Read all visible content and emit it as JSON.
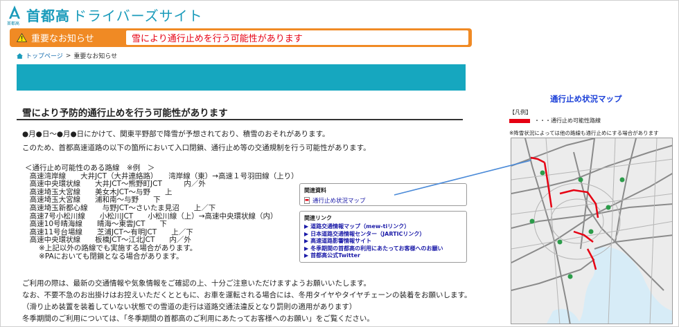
{
  "header": {
    "logo_sub": "首都高",
    "title_kanji": "首都高",
    "title_rest": "ドライバーズサイト"
  },
  "alert": {
    "label": "重要なお知らせ",
    "message": "雪により通行止めを行う可能性があります"
  },
  "breadcrumb": {
    "home": "トップページ",
    "separator": ">",
    "current": "重要なお知らせ"
  },
  "main": {
    "title": "雪により予防的通行止めを行う可能性があります",
    "intro_1": "●月●日～●月●日にかけて、関東平野部で降雪が予想されており、積雪のおそれがあります。",
    "intro_2": "このため、首都高速道路の以下の箇所において入口閉鎖、通行止め等の交通規制を行う可能性があります。",
    "routes_header": "＜通行止め可能性のある路線　※例　＞",
    "routes": [
      "  高速湾岸線　　大井JCT（大井連絡路）　　湾岸線（東）→高速１号羽田線（上り）",
      "  高速中央環状線　　大井JCT～熊野町JCT　　　内／外",
      "  高速埼玉大宮線　　美女木JCT～与野　　上",
      "  高速埼玉大宮線　　浦和南～与野　　下",
      "  高速埼玉新都心線　　与野JCT～さいたま見沼　　上／下",
      "  高速7号小松川線　　小松川JCT　　小松川線（上）→高速中央環状線（内）",
      "  高速10号晴海線　　晴海～東雲JCT　　下",
      "  高速11号台場線　　芝浦JCT～有明JCT　　上／下",
      "  高速中央環状線　　板橋JCT～江北JCT　　内／外"
    ],
    "routes_note_1": "      ※上記以外の路線でも実施する場合があります。",
    "routes_note_2": "      ※PAにおいても閉鎖となる場合があります。",
    "closing_1": "ご利用の際は、最新の交通情報や気象情報をご確認の上、十分ご注意いただけますようお願いいたします。",
    "closing_2": "なお、不要不急のお出掛けはお控えいただくとともに、お車を運転される場合には、冬用タイヤやタイヤチェーンの装着をお願いします。",
    "closing_3": "（滑り止め装置を装着していない状態での雪道の走行は道路交通法違反となり罰則の適用があります）",
    "closing_4": "冬季期間のご利用については、「冬季期間の首都高のご利用にあたってお客様へのお願い」をご覧ください。"
  },
  "related_docs": {
    "title": "関連資料",
    "link": "通行止め状況マップ"
  },
  "related_links": {
    "title": "関連リンク",
    "items": [
      "道路交通情報マップ（mew-tiリンク）",
      "日本道路交通情報センター（JARTICリンク）",
      "高速道路影響情報サイト",
      "冬季期間の首都高の利用にあたってお客様へのお願い",
      "首都高公式Twitter"
    ]
  },
  "map_panel": {
    "heading": "通行止め状況マップ",
    "legend_title": "【凡例】",
    "legend_item": "・・・通行止め可能性路線",
    "note": "※降雪状況によっては他の路線も通行止めにする場合があります"
  },
  "colors": {
    "brand": "#1a9bbb",
    "alert_orange": "#f08a24",
    "alert_red": "#e60012",
    "teal_band": "#16a7bf",
    "link_blue": "#1a1aa8",
    "map_heading": "#1a3fd8",
    "connector": "#4a8ad8"
  }
}
